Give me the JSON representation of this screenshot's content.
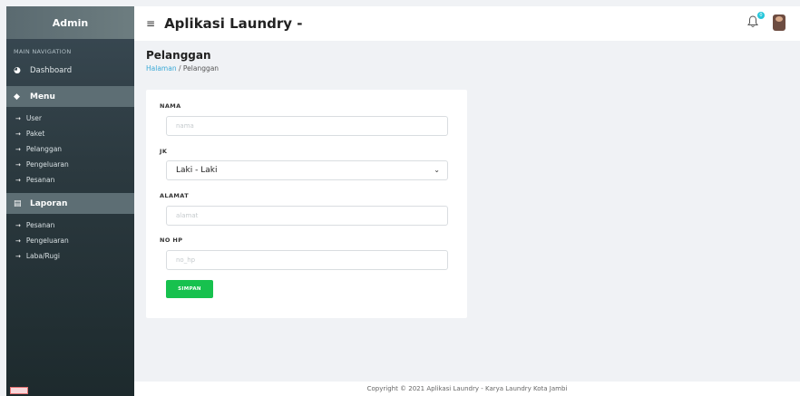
{
  "sidebar": {
    "brand": "Admin",
    "section_label": "MAIN NAVIGATION",
    "dashboard_label": "Dashboard",
    "menu_header": "Menu",
    "menu_items": [
      {
        "label": "User"
      },
      {
        "label": "Paket"
      },
      {
        "label": "Pelanggan"
      },
      {
        "label": "Pengeluaran"
      },
      {
        "label": "Pesanan"
      }
    ],
    "laporan_header": "Laporan",
    "laporan_items": [
      {
        "label": "Pesanan"
      },
      {
        "label": "Pengeluaran"
      },
      {
        "label": "Laba/Rugi"
      }
    ]
  },
  "topbar": {
    "menu_glyph": "≡",
    "title": "Aplikasi Laundry -",
    "notification_count": "0"
  },
  "page": {
    "title": "Pelanggan",
    "breadcrumb_home": "Halaman",
    "breadcrumb_sep": "/",
    "breadcrumb_current": "Pelanggan"
  },
  "form": {
    "nama_label": "NAMA",
    "nama_placeholder": "nama",
    "jk_label": "JK",
    "jk_selected": "Laki - Laki",
    "alamat_label": "ALAMAT",
    "alamat_placeholder": "alamat",
    "nohp_label": "NO HP",
    "nohp_placeholder": "no_hp",
    "submit_label": "SIMPAN"
  },
  "footer": {
    "text": "Copyright © 2021 Aplikasi Laundry - Karya Laundry Kota Jambi"
  },
  "colors": {
    "accent_green": "#17c14e",
    "link_blue": "#3aa9d6",
    "badge_cyan": "#26c6da"
  }
}
